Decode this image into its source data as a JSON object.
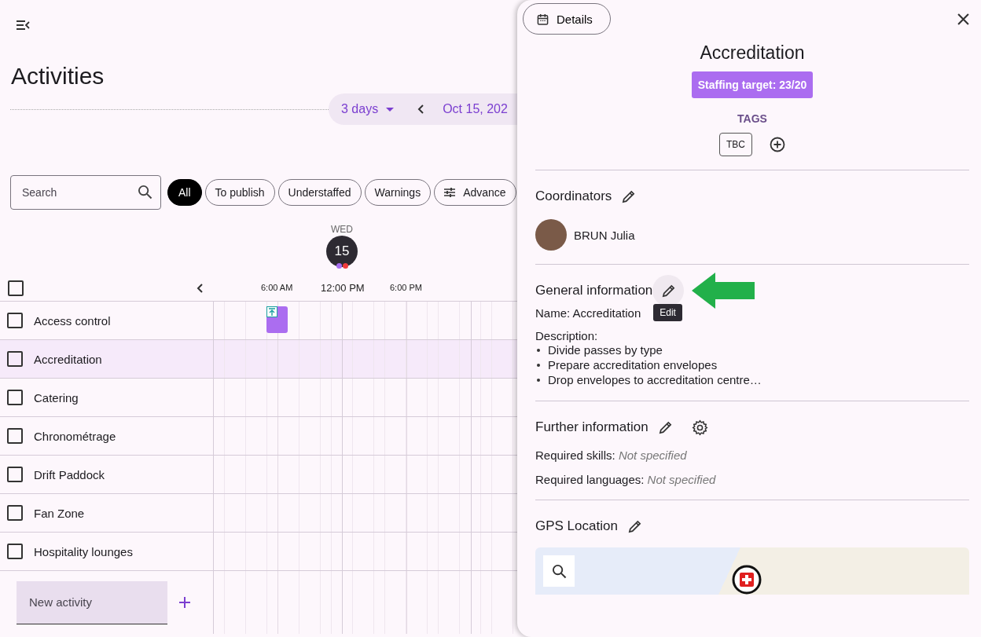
{
  "title": "Activities",
  "date_nav": {
    "view": "3 days",
    "date": "Oct 15, 202"
  },
  "search": {
    "placeholder": "Search"
  },
  "filters": [
    {
      "label": "All",
      "kind": "chip",
      "selected": true
    },
    {
      "label": "To publish",
      "kind": "chip",
      "selected": false
    },
    {
      "label": "Understaffed",
      "kind": "chip",
      "selected": false
    },
    {
      "label": "Warnings",
      "kind": "chip",
      "selected": false
    },
    {
      "label": "Advance",
      "kind": "advanced",
      "selected": false
    }
  ],
  "day": {
    "weekday": "WED",
    "date": "15",
    "dots": [
      {
        "color": "#a66cf0"
      },
      {
        "color": "#f03c3c"
      }
    ]
  },
  "select_all": {
    "checked": false
  },
  "time_labels": [
    {
      "label": "6:00 AM",
      "current": false
    },
    {
      "label": "12:00 PM",
      "current": true
    },
    {
      "label": "6:00 PM",
      "current": false
    }
  ],
  "activities": [
    {
      "name": "Access control",
      "checked": false,
      "selected": false,
      "event": true
    },
    {
      "name": "Accreditation",
      "checked": false,
      "selected": true,
      "event": false
    },
    {
      "name": "Catering",
      "checked": false,
      "selected": false,
      "event": false
    },
    {
      "name": "Chronométrage",
      "checked": false,
      "selected": false,
      "event": false
    },
    {
      "name": "Drift Paddock",
      "checked": false,
      "selected": false,
      "event": false
    },
    {
      "name": "Fan Zone",
      "checked": false,
      "selected": false,
      "event": false
    },
    {
      "name": "Hospitality lounges",
      "checked": false,
      "selected": false,
      "event": false
    }
  ],
  "new_activity": {
    "placeholder": "New activity"
  },
  "panel": {
    "tab": "Details",
    "title": "Accreditation",
    "staffing": "Staffing target: 23/20",
    "tags_label": "TAGS",
    "tags": [
      "TBC"
    ],
    "coordinators": {
      "heading": "Coordinators",
      "people": [
        "BRUN Julia"
      ]
    },
    "general": {
      "heading": "General information",
      "tooltip": "Edit",
      "name_label": "Name:",
      "name": "Accreditation",
      "description_label": "Description:",
      "description": [
        "Divide passes by type",
        "Prepare accreditation envelopes",
        "Drop envelopes to accreditation centre…"
      ]
    },
    "further": {
      "heading": "Further information",
      "fields": [
        {
          "label": "Required skills:",
          "value": "Not specified"
        },
        {
          "label": "Required languages:",
          "value": "Not specified"
        }
      ]
    },
    "gps": {
      "heading": "GPS Location"
    }
  }
}
